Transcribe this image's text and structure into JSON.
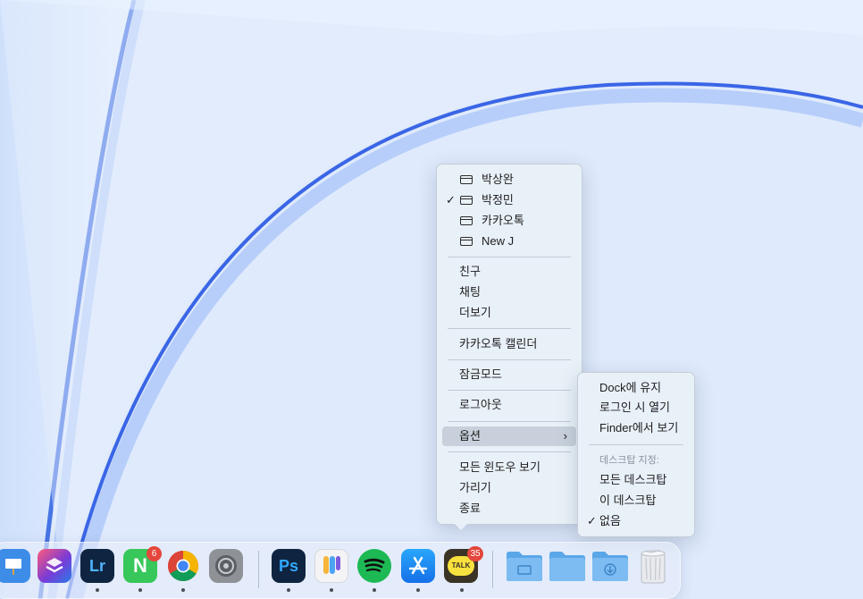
{
  "context_menu": {
    "windows": [
      {
        "label": "박상완",
        "checked": false
      },
      {
        "label": "박정민",
        "checked": true
      },
      {
        "label": "카카오톡",
        "checked": false
      },
      {
        "label": "New J",
        "checked": false
      }
    ],
    "friends": "친구",
    "chat": "채팅",
    "more": "더보기",
    "calendar": "카카오톡 캘린더",
    "lock_mode": "잠금모드",
    "logout": "로그아웃",
    "options": "옵션",
    "show_all_windows": "모든 윈도우 보기",
    "hide": "가리기",
    "quit": "종료"
  },
  "options_submenu": {
    "keep_in_dock": "Dock에 유지",
    "open_at_login": "로그인 시 열기",
    "show_in_finder": "Finder에서 보기",
    "assign_desktop_title": "데스크탑 지정:",
    "all_desktops": "모든 데스크탑",
    "this_desktop": "이 데스크탑",
    "none": "없음",
    "check_mark": "✓"
  },
  "dock": {
    "apps": [
      {
        "name": "keynote-icon",
        "color": "#3d8ce8",
        "text": ""
      },
      {
        "name": "shortcuts-icon",
        "color": "#5b3fa8",
        "text": ""
      },
      {
        "name": "lightroom-icon",
        "color": "#0f2440",
        "text": "Lr"
      },
      {
        "name": "naver-icon",
        "color": "#38c75a",
        "text": "N"
      },
      {
        "name": "chrome-icon",
        "color": "#ffffff",
        "text": ""
      },
      {
        "name": "system-settings-icon",
        "color": "#8e9196",
        "text": ""
      },
      {
        "name": "photoshop-icon",
        "color": "#0f2440",
        "text": "Ps"
      },
      {
        "name": "passwords-icon",
        "color": "#f4f4f6",
        "text": ""
      },
      {
        "name": "spotify-icon",
        "color": "#1db954",
        "text": ""
      },
      {
        "name": "app-store-icon",
        "color": "#1f8df2",
        "text": ""
      },
      {
        "name": "kakaotalk-icon",
        "color": "#3b3325",
        "text": "TALK"
      }
    ],
    "naver_badge": "6",
    "kakaotalk_badge": "35",
    "folders": [
      "folder-icon",
      "folder-icon",
      "downloads-folder-icon"
    ],
    "trash": "trash-icon"
  }
}
